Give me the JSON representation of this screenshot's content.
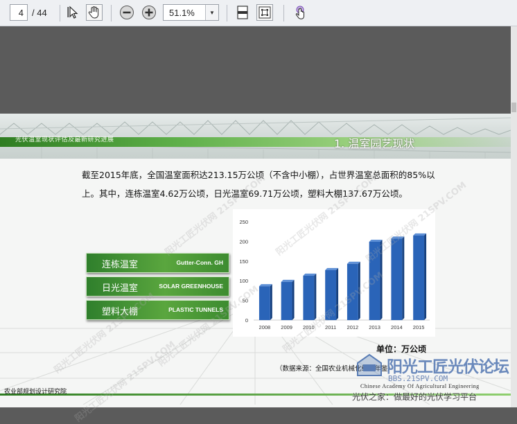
{
  "toolbar": {
    "page_current": "4",
    "page_total": "/ 44",
    "zoom_value": "51.1%",
    "icons": [
      "select-arrow-icon",
      "hand-tool-icon",
      "zoom-out-icon",
      "zoom-in-icon",
      "fit-page-icon",
      "fit-width-icon",
      "touch-mode-icon"
    ]
  },
  "slide": {
    "banner_subtitle": "光伏温室现状评估及最新研究进展",
    "banner_title": "1. 温室园艺现状",
    "body_text": "截至2015年底，全国温室面积达213.15万公顷（不含中小棚），占世界温室总面积的85%以上。其中，连栋温室4.62万公顷，日光温室69.71万公顷，塑料大棚137.67万公顷。",
    "tags": [
      {
        "cn": "连栋温室",
        "en": "Gutter-Conn. GH"
      },
      {
        "cn": "日光温室",
        "en": "SOLAR GREENHOUSE"
      },
      {
        "cn": "塑料大棚",
        "en": "PLASTIC TUNNELS"
      }
    ],
    "unit": "单位：万公顷",
    "source": "（数据来源：全国农业机械化统计年鉴）",
    "institute_cn": "农业部规划设计研究院",
    "institute_en": "Chinese Academy Of Agricultural Engineering"
  },
  "watermark": {
    "text": "阳光工匠光伏网 21SPV.COM",
    "logo_text": "阳光工匠光伏论坛",
    "logo_url": "BBS.21SPV.COM",
    "footer": "光伏之家：做最好的光伏学习平台"
  },
  "colors": {
    "bar": "#2a64b8",
    "accent_green": "#4d9a34"
  },
  "chart_data": {
    "type": "bar",
    "categories": [
      "2008",
      "2009",
      "2010",
      "2011",
      "2012",
      "2013",
      "2014",
      "2015"
    ],
    "values": [
      86,
      97,
      113,
      127,
      143,
      199,
      207,
      215
    ],
    "ylim": [
      0,
      250
    ],
    "yticks": [
      "0",
      "50",
      "100",
      "150",
      "200",
      "250"
    ],
    "grid": false,
    "title": "",
    "xlabel": "",
    "ylabel": ""
  }
}
